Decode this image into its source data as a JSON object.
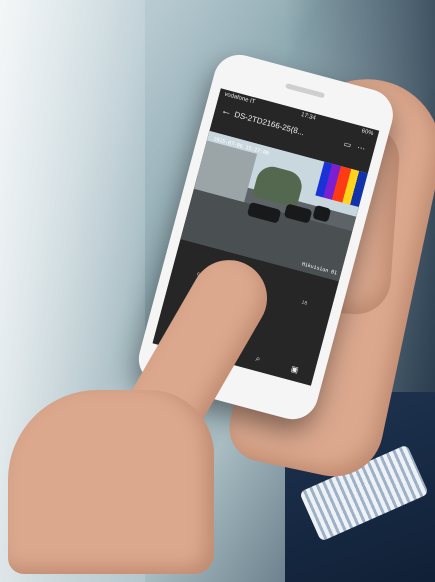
{
  "status_bar": {
    "carrier": "vodafone IT",
    "time": "17:34",
    "battery": "60%"
  },
  "app_bar": {
    "title": "DS-2TD2166-25(8..."
  },
  "video": {
    "overlay_text": "2015-07-06 15:27:00",
    "camera_label": "Hikvision 01"
  },
  "timeline": {
    "labels": [
      "6",
      "12",
      "18"
    ]
  },
  "icons": {
    "back": "arrow-left",
    "share": "share-icon",
    "more": "more-icon",
    "audio": "speaker-icon",
    "pause": "pause-icon",
    "search": "search-icon",
    "screen": "window-icon"
  }
}
